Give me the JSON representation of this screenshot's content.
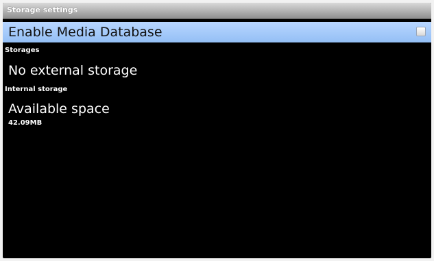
{
  "window": {
    "title": "Storage settings"
  },
  "preferences": {
    "enable_media_database": {
      "label": "Enable Media Database",
      "checked": false
    },
    "storages": {
      "category": "Storages",
      "item_title": "No external storage"
    },
    "internal_storage": {
      "category": "Internal storage",
      "item_title": "Available space",
      "item_summary": "42.09MB"
    }
  },
  "colors": {
    "highlight": "#a8ccfb",
    "background": "#000000",
    "titlebar": "#b0b0b0"
  }
}
